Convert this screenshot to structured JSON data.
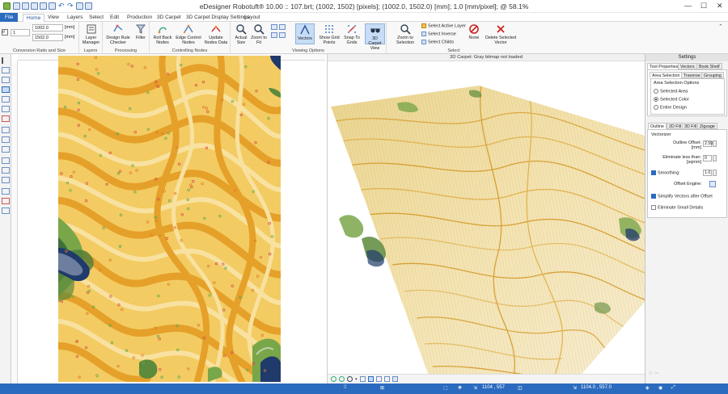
{
  "app": {
    "title": "eDesigner Robotuft® 10.00 :: 107.brt; (1002, 1502) [pixels]; (1002.0, 1502.0) [mm]; 1.0 [mm/pixel]; @ 58.1%"
  },
  "tabs": [
    "File",
    "Home",
    "View",
    "Layers",
    "Select",
    "Edit",
    "Production",
    "3D Carpet",
    "3D Carpet Display Settings",
    "Layout"
  ],
  "ribbon": {
    "conversion": {
      "width": "1002.0",
      "height": "1502.0",
      "unit": "[mm]",
      "ratio": "1",
      "label": "Conversion Ratio and Size"
    },
    "layers": {
      "btn": "Layer Manager",
      "label": "Layers"
    },
    "processing": {
      "btn1": "Design Rule Checker",
      "btn2": "Filter",
      "label": "Processing"
    },
    "nodes": {
      "btn1": "Roll Back Nodes",
      "btn2": "Edge Control Nodes",
      "btn3": "Update Nodes Data",
      "label": "Controlling Nodes"
    },
    "viewing": {
      "actual": "Actual Size",
      "zoomfit": "Zoom to Fit",
      "vectors": "Vectors",
      "grid": "Show Grid Points",
      "snap": "Snap To Grids",
      "carpet3d": "3D Carpet View",
      "label": "Viewing Options"
    },
    "select": {
      "zoomsel": "Zoom to Selection",
      "active": "Select Active Layer",
      "inverse": "Select Inverse",
      "childs": "Select Childs",
      "none": "None",
      "delete": "Delete Selected Vector",
      "label": "Select"
    }
  },
  "view3d": {
    "title": "3D Carpet: Gray bitmap not loaded"
  },
  "settings": {
    "title": "Settings",
    "tabs": [
      "Tool Properties",
      "Vectors",
      "Book Shelf"
    ],
    "subtabs": [
      "Area Selection",
      "Traverse",
      "Grouping"
    ],
    "area_header": "Area Selection Options",
    "area_options": [
      "Selected Area",
      "Selected Color",
      "Entire Design"
    ],
    "area_selected": 1,
    "fill_tabs": [
      "Outline",
      "2D Fill",
      "3D Fill",
      "Zigzage"
    ],
    "vectorizer_label": "Vectorizer",
    "outline_offset_label": "Outline Offset: [mm]",
    "outline_offset": "2.50",
    "eliminate_label": "Eliminate less than: [sqmm]",
    "eliminate": "0",
    "smoothing_label": "Smoothing:",
    "smoothing": "1.0",
    "offset_engine_label": "Offset Engine:",
    "simplify_label": "Simplify Vectors after Offset",
    "small_details_label": "Eliminate Small Details"
  },
  "status": {
    "coords1": "1104 , 557",
    "coords2": "1104.0 , 557.0"
  },
  "colors": {
    "accent": "#2b6bbf",
    "carpet_yellow": "#f2c65a",
    "carpet_orange": "#e8a02a",
    "carpet_cream": "#fbe7a9",
    "carpet_green": "#7aa64a",
    "carpet_navy": "#1f3a6b"
  }
}
